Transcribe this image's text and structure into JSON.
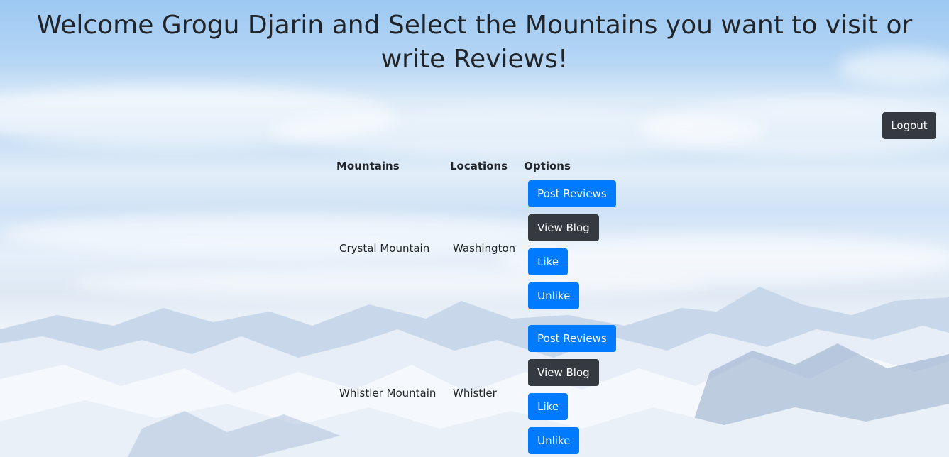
{
  "header": {
    "title": "Welcome Grogu Djarin and Select the Mountains you want to visit or write Reviews!",
    "logout_label": "Logout"
  },
  "table": {
    "columns": [
      "Mountains",
      "Locations",
      "Options"
    ],
    "rows": [
      {
        "mountain": "Crystal Mountain",
        "location": "Washington",
        "buttons": {
          "post_reviews": "Post Reviews",
          "view_blog": "View Blog",
          "like": "Like",
          "unlike": "Unlike"
        }
      },
      {
        "mountain": "Whistler Mountain",
        "location": "Whistler",
        "buttons": {
          "post_reviews": "Post Reviews",
          "view_blog": "View Blog",
          "like": "Like",
          "unlike": "Unlike"
        }
      }
    ]
  },
  "colors": {
    "primary": "#007bff",
    "dark": "#343a40",
    "text": "#212529"
  }
}
